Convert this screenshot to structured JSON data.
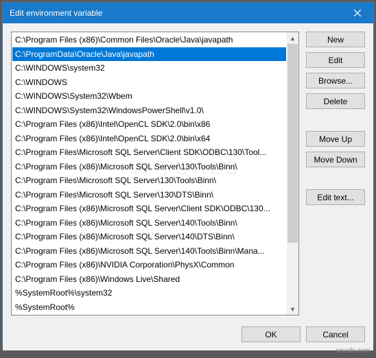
{
  "window": {
    "title": "Edit environment variable"
  },
  "list": {
    "selected_index": 1,
    "items": [
      "C:\\Program Files (x86)\\Common Files\\Oracle\\Java\\javapath",
      "C:\\ProgramData\\Oracle\\Java\\javapath",
      "C:\\WINDOWS\\system32",
      "C:\\WINDOWS",
      "C:\\WINDOWS\\System32\\Wbem",
      "C:\\WINDOWS\\System32\\WindowsPowerShell\\v1.0\\",
      "C:\\Program Files (x86)\\Intel\\OpenCL SDK\\2.0\\bin\\x86",
      "C:\\Program Files (x86)\\Intel\\OpenCL SDK\\2.0\\bin\\x64",
      "C:\\Program Files\\Microsoft SQL Server\\Client SDK\\ODBC\\130\\Tool...",
      "C:\\Program Files (x86)\\Microsoft SQL Server\\130\\Tools\\Binn\\",
      "C:\\Program Files\\Microsoft SQL Server\\130\\Tools\\Binn\\",
      "C:\\Program Files\\Microsoft SQL Server\\130\\DTS\\Binn\\",
      "C:\\Program Files (x86)\\Microsoft SQL Server\\Client SDK\\ODBC\\130...",
      "C:\\Program Files (x86)\\Microsoft SQL Server\\140\\Tools\\Binn\\",
      "C:\\Program Files (x86)\\Microsoft SQL Server\\140\\DTS\\Binn\\",
      "C:\\Program Files (x86)\\Microsoft SQL Server\\140\\Tools\\Binn\\Mana...",
      "C:\\Program Files (x86)\\NVIDIA Corporation\\PhysX\\Common",
      "C:\\Program Files (x86)\\Windows Live\\Shared",
      "%SystemRoot%\\system32",
      "%SystemRoot%"
    ]
  },
  "buttons": {
    "new": "New",
    "edit": "Edit",
    "browse": "Browse...",
    "delete": "Delete",
    "move_up": "Move Up",
    "move_down": "Move Down",
    "edit_text": "Edit text...",
    "ok": "OK",
    "cancel": "Cancel"
  },
  "attrib": "wsxdn.com",
  "watermark": "A TUALS"
}
